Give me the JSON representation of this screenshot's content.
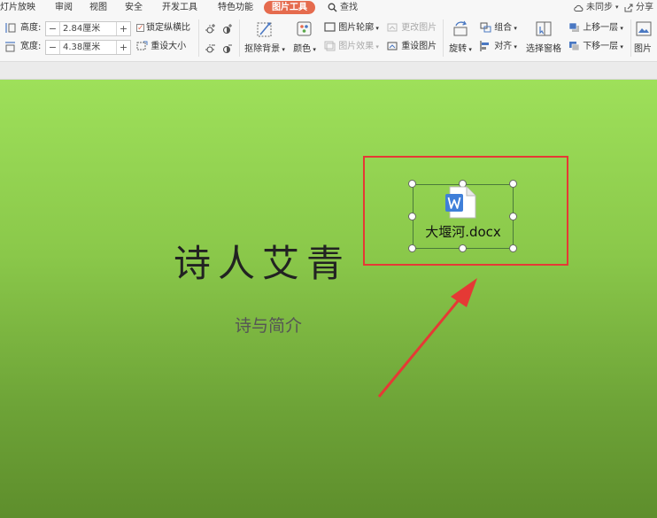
{
  "tabs": {
    "slideshow": "灯片放映",
    "review": "审阅",
    "view": "视图",
    "security": "安全",
    "developer": "开发工具",
    "special": "特色功能",
    "picture_tools": "图片工具",
    "search": "查找",
    "unsync": "未同步",
    "share": "分享"
  },
  "ribbon": {
    "height_label": "高度:",
    "height_value": "2.84厘米",
    "width_label": "宽度:",
    "width_value": "4.38厘米",
    "minus": "−",
    "plus": "+",
    "lock_ratio": "锁定纵横比",
    "reset_size": "重设大小",
    "remove_bg": "抠除背景",
    "color": "颜色",
    "outline": "图片轮廓",
    "effects": "图片效果",
    "change_pic": "更改图片",
    "reset_pic": "重设图片",
    "rotate": "旋转",
    "group": "组合",
    "align": "对齐",
    "selection_pane": "选择窗格",
    "bring_forward": "上移一层",
    "send_backward": "下移一层",
    "picture": "图片"
  },
  "slide": {
    "title": "诗人艾青",
    "subtitle": "诗与简介",
    "embedded_file": "大堰河.docx"
  },
  "colors": {
    "accent": "#e56b4e",
    "highlight_box": "#e53935",
    "slide_top": "#9ee05a",
    "slide_bottom": "#5e8e2c"
  }
}
